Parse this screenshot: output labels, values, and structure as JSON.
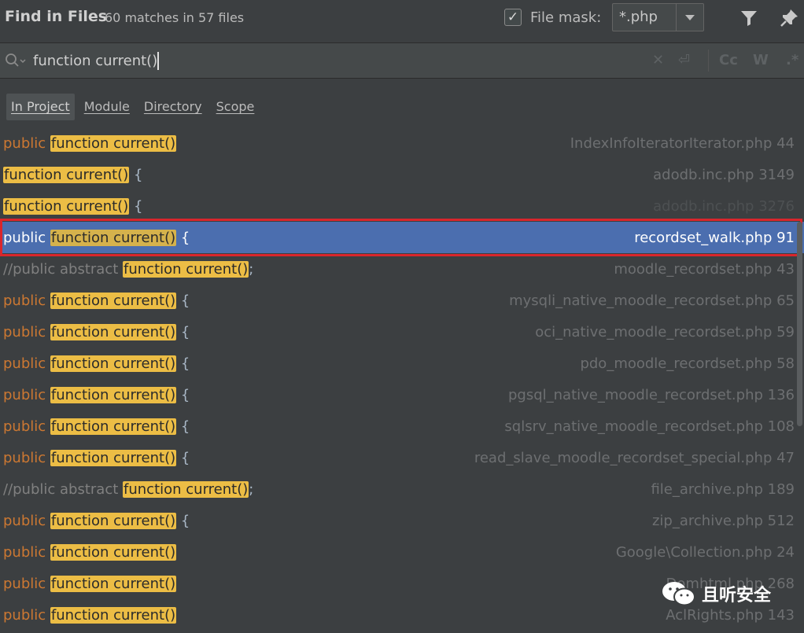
{
  "header": {
    "title": "Find in Files",
    "summary": "60 matches in 57 files",
    "file_mask_checked": true,
    "file_mask_label": "File mask:",
    "file_mask_value": "*.php"
  },
  "search": {
    "query": "function current()",
    "tools": [
      "Cc",
      "W",
      ".*"
    ]
  },
  "scope_tabs": [
    {
      "label": "In Project",
      "active": true
    },
    {
      "label": "Module",
      "active": false
    },
    {
      "label": "Directory",
      "active": false
    },
    {
      "label": "Scope",
      "active": false
    }
  ],
  "results": [
    {
      "prefix": "public",
      "prefix_type": "keyword",
      "match": "function current()",
      "suffix": "",
      "file": "IndexInfoIteratorIterator.php 44"
    },
    {
      "prefix": "",
      "prefix_type": "keyword",
      "match": "function current()",
      "suffix": " {",
      "file": "adodb.inc.php 3149"
    },
    {
      "prefix": "",
      "prefix_type": "keyword",
      "match": "function current()",
      "suffix": " {",
      "file": "adodb.inc.php 3276",
      "dim": true
    },
    {
      "prefix": "public",
      "prefix_type": "keyword",
      "match": "function current()",
      "suffix": " {",
      "file": "recordset_walk.php 91",
      "selected": true
    },
    {
      "prefix": "//public abstract",
      "prefix_type": "comment",
      "match": "function current()",
      "suffix": ";",
      "file": "moodle_recordset.php 43"
    },
    {
      "prefix": "public",
      "prefix_type": "keyword",
      "match": "function current()",
      "suffix": " {",
      "file": "mysqli_native_moodle_recordset.php 65"
    },
    {
      "prefix": "public",
      "prefix_type": "keyword",
      "match": "function current()",
      "suffix": " {",
      "file": "oci_native_moodle_recordset.php 59"
    },
    {
      "prefix": "public",
      "prefix_type": "keyword",
      "match": "function current()",
      "suffix": " {",
      "file": "pdo_moodle_recordset.php 58"
    },
    {
      "prefix": "public",
      "prefix_type": "keyword",
      "match": "function current()",
      "suffix": " {",
      "file": "pgsql_native_moodle_recordset.php 136"
    },
    {
      "prefix": "public",
      "prefix_type": "keyword",
      "match": "function current()",
      "suffix": " {",
      "file": "sqlsrv_native_moodle_recordset.php 108"
    },
    {
      "prefix": "public",
      "prefix_type": "keyword",
      "match": "function current()",
      "suffix": " {",
      "file": "read_slave_moodle_recordset_special.php 47"
    },
    {
      "prefix": "//public abstract",
      "prefix_type": "comment",
      "match": "function current()",
      "suffix": ";",
      "file": "file_archive.php 189"
    },
    {
      "prefix": "public",
      "prefix_type": "keyword",
      "match": "function current()",
      "suffix": " {",
      "file": "zip_archive.php 512"
    },
    {
      "prefix": "public",
      "prefix_type": "keyword",
      "match": "function current()",
      "suffix": "",
      "file": "Google\\Collection.php 24"
    },
    {
      "prefix": "public",
      "prefix_type": "keyword",
      "match": "function current()",
      "suffix": "",
      "file": "Domhtml.php 268"
    },
    {
      "prefix": "public",
      "prefix_type": "keyword",
      "match": "function current()",
      "suffix": "",
      "file": "AclRights.php 143"
    }
  ],
  "watermark": {
    "text": "且听安全"
  },
  "colors": {
    "background": "#3c3f41",
    "selection": "#4b6eaf",
    "match_highlight": "#ecbd45",
    "keyword": "#cc7832",
    "frame": "#d9262c"
  }
}
